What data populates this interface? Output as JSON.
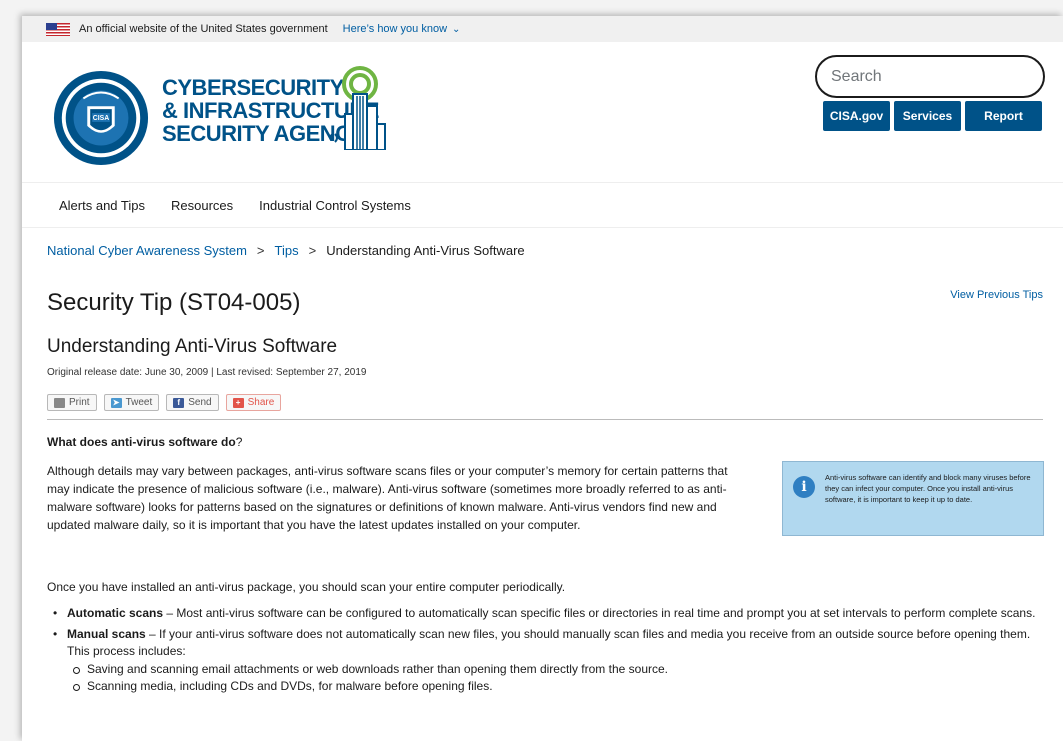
{
  "gov_banner": {
    "text": "An official website of the United States government",
    "how_link": "Here’s how you know"
  },
  "header": {
    "agency_line1": "CYBERSECURITY",
    "agency_line2": "& INFRASTRUCTURE",
    "agency_line3": "SECURITY AGENCY",
    "seal_text": "CISA",
    "search_placeholder": "Search",
    "buttons": [
      "CISA.gov",
      "Services",
      "Report"
    ]
  },
  "nav": {
    "items": [
      "Alerts and Tips",
      "Resources",
      "Industrial Control Systems"
    ]
  },
  "breadcrumb": {
    "items": [
      "National Cyber Awareness System",
      "Tips",
      "Understanding Anti-Virus Software"
    ],
    "separator": ">"
  },
  "article": {
    "title": "Security Tip (ST04-005)",
    "view_previous": "View Previous Tips",
    "subtitle": "Understanding Anti-Virus Software",
    "dates": "Original release date: June 30, 2009 | Last revised: September 27, 2019",
    "share": [
      "Print",
      "Tweet",
      "Send",
      "Share"
    ],
    "q_heading": "What does anti-virus software do",
    "q_mark": "?",
    "para1": "Although details may vary between packages, anti-virus software scans files or your computer’s memory for certain patterns that may indicate the presence of malicious software (i.e., malware). Anti-virus software (sometimes more broadly referred to as anti-malware software) looks for patterns based on the signatures or definitions of known malware. Anti-virus vendors find new and updated malware daily, so it is important that you have the latest updates installed on your computer.",
    "para2": "Once you have installed an anti-virus package, you should scan your entire computer periodically.",
    "callout": "Anti-virus software can identify and block many viruses before they can infect your computer. Once you install anti-virus software, it is important to keep it up to date.",
    "bullets": [
      {
        "bold": "Automatic scans",
        "text": " – Most anti-virus software can be configured to automatically scan specific files or directories in real time and prompt you at set intervals to perform complete scans."
      },
      {
        "bold": "Manual scans",
        "text": " – If your anti-virus software does not automatically scan new files, you should manually scan files and media you receive from an outside source before opening them. This process includes:"
      }
    ],
    "sub_bullets": [
      "Saving and scanning email attachments or web downloads rather than opening them directly from the source.",
      "Scanning media, including CDs and DVDs, for malware before opening files."
    ]
  },
  "colors": {
    "brand": "#005288",
    "link": "#005ea2",
    "callout_bg": "#b1d8ef"
  }
}
